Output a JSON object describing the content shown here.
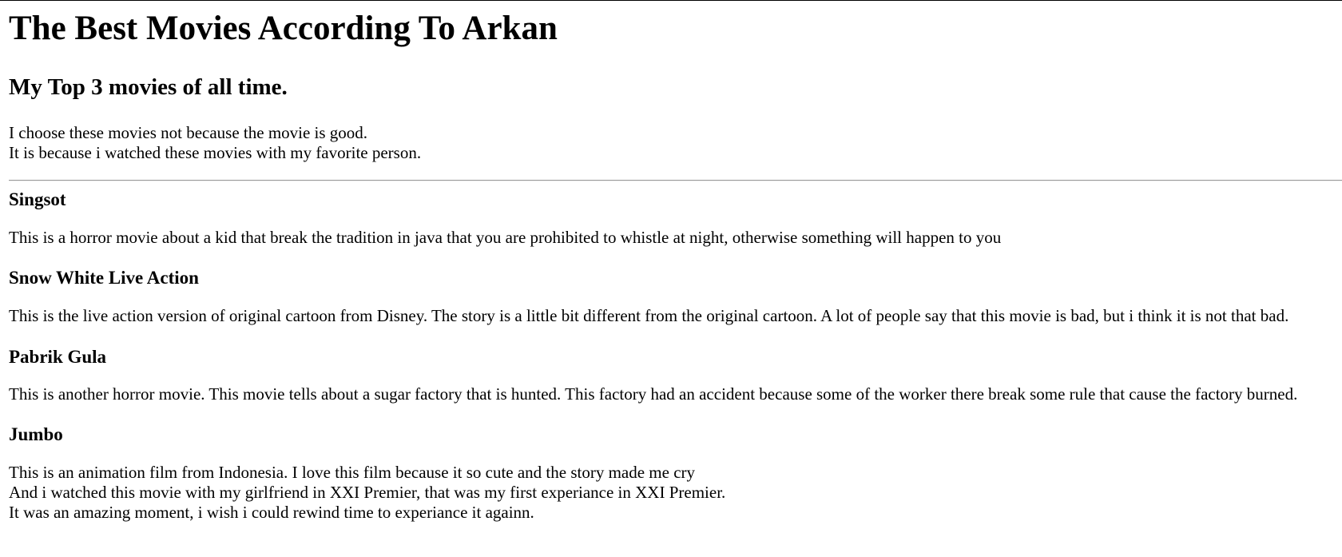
{
  "page": {
    "title": "The Best Movies According To Arkan",
    "subtitle": "My Top 3 movies of all time.",
    "intro": {
      "line1": "I choose these movies not because the movie is good.",
      "line2": "It is because i watched these movies with my favorite person."
    }
  },
  "movies": [
    {
      "title": "Singsot",
      "lines": [
        "This is a horror movie about a kid that break the tradition in java that you are prohibited to whistle at night, otherwise something will happen to you"
      ]
    },
    {
      "title": "Snow White Live Action",
      "lines": [
        "This is the live action version of original cartoon from Disney. The story is a little bit different from the original cartoon. A lot of people say that this movie is bad, but i think it is not that bad."
      ]
    },
    {
      "title": "Pabrik Gula",
      "lines": [
        "This is another horror movie. This movie tells about a sugar factory that is hunted. This factory had an accident because some of the worker there break some rule that cause the factory burned."
      ]
    },
    {
      "title": "Jumbo",
      "lines": [
        "This is an animation film from Indonesia. I love this film because it so cute and the story made me cry",
        "And i watched this movie with my girlfriend in XXI Premier, that was my first experiance in XXI Premier.",
        "It was an amazing moment, i wish i could rewind time to experiance it againn."
      ]
    }
  ]
}
